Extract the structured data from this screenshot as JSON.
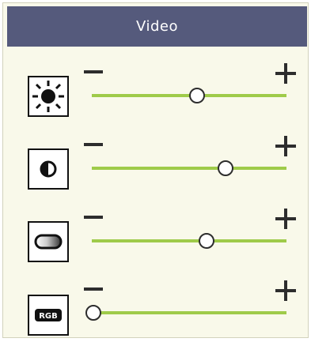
{
  "header": {
    "title": "Video"
  },
  "controls": [
    {
      "name": "brightness",
      "icon": "brightness-icon",
      "minus_label": "−",
      "plus_label": "+",
      "level": 0.54
    },
    {
      "name": "contrast",
      "icon": "contrast-icon",
      "minus_label": "−",
      "plus_label": "+",
      "level": 0.69
    },
    {
      "name": "saturation",
      "icon": "saturation-icon",
      "minus_label": "−",
      "plus_label": "+",
      "level": 0.59
    },
    {
      "name": "rgb",
      "icon": "rgb-icon",
      "icon_text": "RGB",
      "minus_label": "−",
      "plus_label": "+",
      "level": 0.0
    }
  ],
  "colors": {
    "header_bg": "#555a7c",
    "panel_bg": "#f9f9ea",
    "track": "#9fcb4a"
  }
}
